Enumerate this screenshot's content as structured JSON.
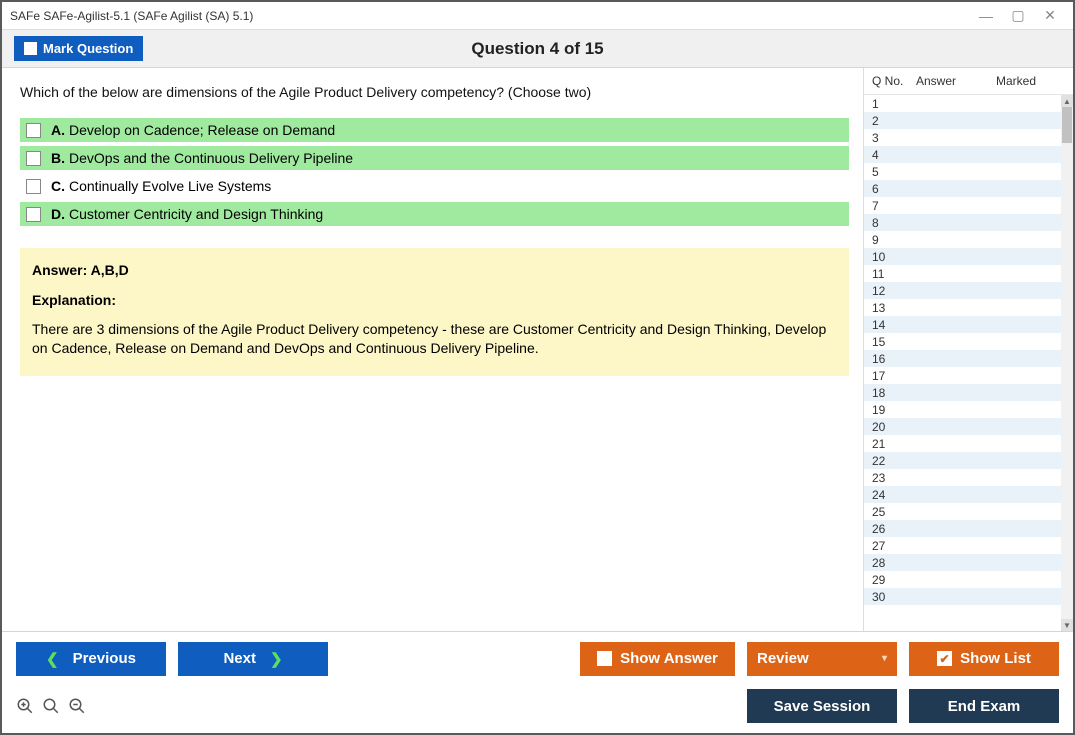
{
  "window": {
    "title": "SAFe SAFe-Agilist-5.1 (SAFe Agilist (SA) 5.1)"
  },
  "toolbar": {
    "mark_label": "Mark Question",
    "question_title": "Question 4 of 15"
  },
  "question": {
    "text": "Which of the below are dimensions of the Agile Product Delivery competency? (Choose two)",
    "options": [
      {
        "letter": "A.",
        "text": "Develop on Cadence; Release on Demand",
        "highlight": true
      },
      {
        "letter": "B.",
        "text": "DevOps and the Continuous Delivery Pipeline",
        "highlight": true
      },
      {
        "letter": "C.",
        "text": "Continually Evolve Live Systems",
        "highlight": false
      },
      {
        "letter": "D.",
        "text": "Customer Centricity and Design Thinking",
        "highlight": true
      }
    ]
  },
  "answer": {
    "line": "Answer: A,B,D",
    "exp_head": "Explanation:",
    "exp_body": "There are 3 dimensions of the Agile Product Delivery competency - these are Customer Centricity and Design Thinking, Develop on Cadence, Release on Demand and DevOps and Continuous Delivery Pipeline."
  },
  "sidebar": {
    "headers": {
      "qno": "Q No.",
      "answer": "Answer",
      "marked": "Marked"
    },
    "rows": [
      1,
      2,
      3,
      4,
      5,
      6,
      7,
      8,
      9,
      10,
      11,
      12,
      13,
      14,
      15,
      16,
      17,
      18,
      19,
      20,
      21,
      22,
      23,
      24,
      25,
      26,
      27,
      28,
      29,
      30
    ]
  },
  "footer": {
    "previous": "Previous",
    "next": "Next",
    "show_answer": "Show Answer",
    "review": "Review",
    "show_list": "Show List",
    "save_session": "Save Session",
    "end_exam": "End Exam"
  }
}
